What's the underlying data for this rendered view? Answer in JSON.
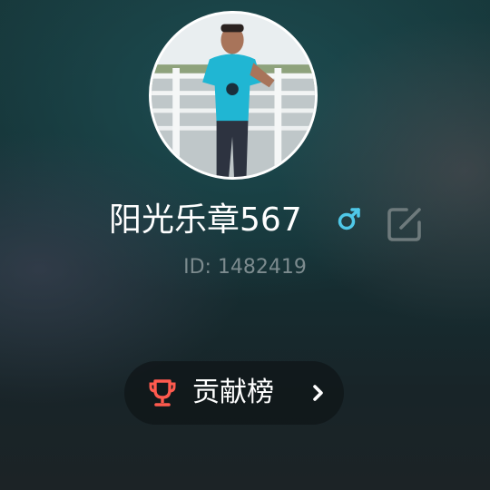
{
  "profile": {
    "username": "阳光乐章567",
    "id_text": "ID: 1482419",
    "gender_icon": "male-symbol",
    "edit_icon": "edit-square-icon"
  },
  "actions": {
    "rank_label": "贡献榜",
    "rank_icon": "trophy",
    "rank_chevron": "chevron-right"
  },
  "colors": {
    "accent_gender": "#4fc8e8",
    "trophy": "#ff5a4e",
    "id_text": "#7c8b8e"
  }
}
